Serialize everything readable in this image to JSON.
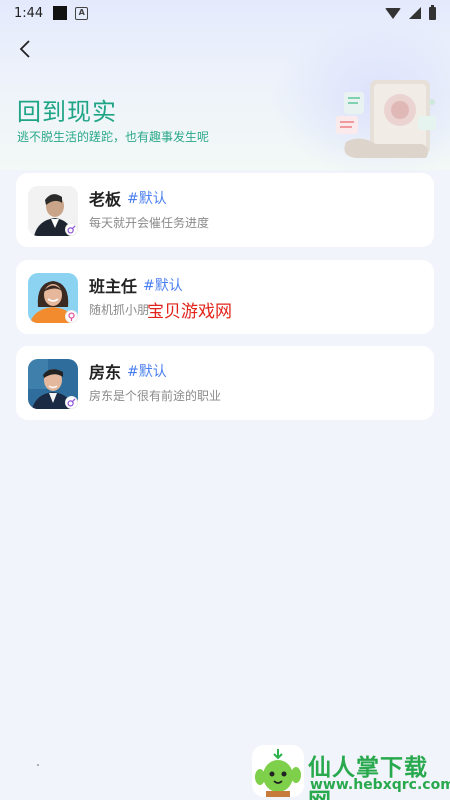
{
  "status_bar": {
    "time": "1:44",
    "a_icon_letter": "A"
  },
  "header": {
    "title": "回到现实",
    "subtitle": "逃不脱生活的蹉跎，也有趣事发生呢"
  },
  "colors": {
    "title": "#1fa586",
    "tag": "#4a7ff0",
    "background": "#f2f4fb",
    "watermark": "#e2231a",
    "footer": "#29a94e"
  },
  "roles": [
    {
      "name": "老板",
      "tag": "#默认",
      "description": "每天就开会催任务进度",
      "gender": "male"
    },
    {
      "name": "班主任",
      "tag": "#默认",
      "description": "随机抓小朋",
      "gender": "female"
    },
    {
      "name": "房东",
      "tag": "#默认",
      "description": "房东是个很有前途的职业",
      "gender": "male"
    }
  ],
  "watermark": {
    "text": "宝贝游戏网"
  },
  "footer": {
    "name": "仙人掌下载网",
    "url": "www.hebxqrc.com"
  }
}
